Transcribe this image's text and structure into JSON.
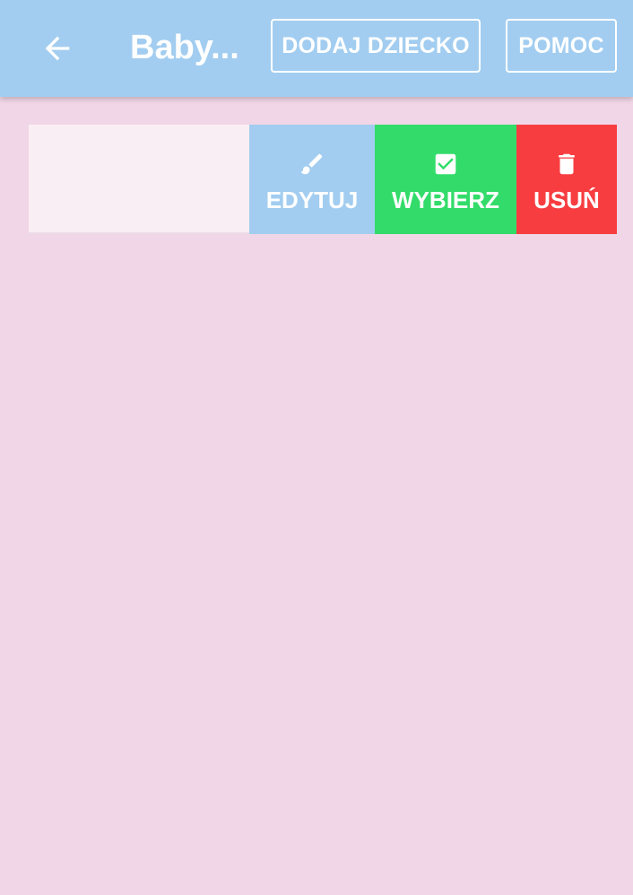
{
  "app_bar": {
    "title": "Baby...",
    "back_icon": "arrow-left-icon",
    "add_child_label": "DODAJ DZIECKO",
    "help_label": "POMOC",
    "background": "#a2cdf0"
  },
  "list": {
    "rows": [
      {
        "content_text": "",
        "actions": [
          {
            "label": "EDYTUJ",
            "icon": "brush-icon",
            "color": "#a2cdf0"
          },
          {
            "label": "WYBIERZ",
            "icon": "checkbox-icon",
            "color": "#33dc6a"
          },
          {
            "label": "USUŃ",
            "icon": "trash-icon",
            "color": "#f83d40"
          }
        ]
      }
    ]
  },
  "page": {
    "background": "#f0d6e6"
  }
}
